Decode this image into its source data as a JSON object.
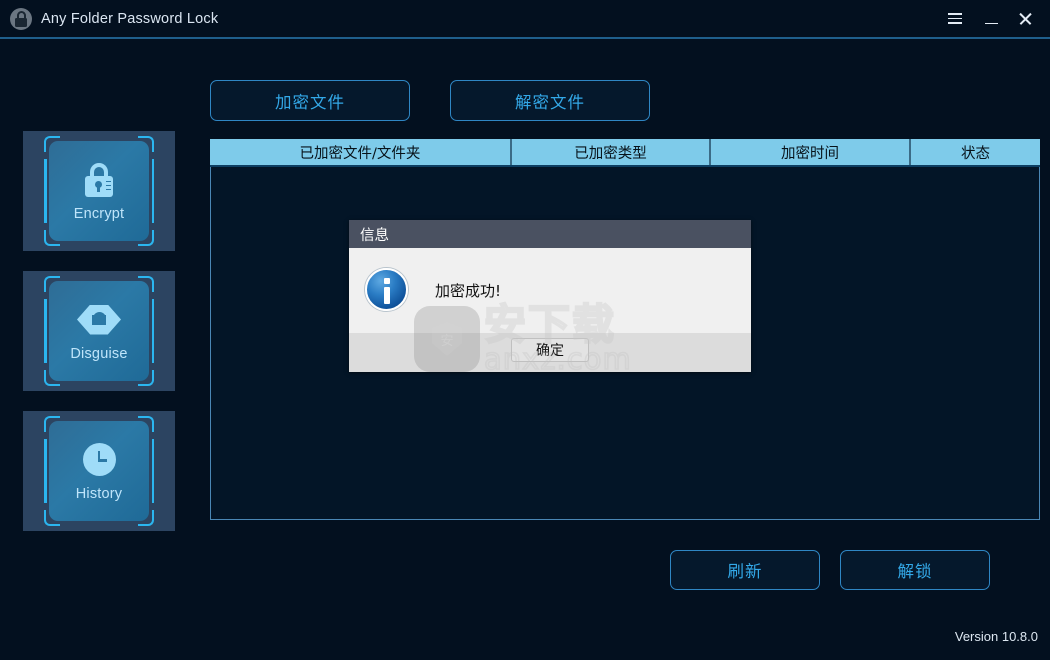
{
  "window": {
    "title": "Any Folder Password Lock",
    "logo_icon": "lock-logo-icon",
    "controls": {
      "menu_icon": "hamburger-menu-icon",
      "minimize_icon": "minimize-icon",
      "close_icon": "close-icon"
    }
  },
  "theme": {
    "background": "#03101f",
    "accent": "#33a8e8",
    "accent_border": "#2f86c4",
    "bracket": "#2bb6f0",
    "table_header_bg": "#7ecbea",
    "sidebar_card_bg": "#2c4461"
  },
  "sidebar": {
    "items": [
      {
        "label": "Encrypt",
        "icon": "lock-icon"
      },
      {
        "label": "Disguise",
        "icon": "disguise-mask-icon"
      },
      {
        "label": "History",
        "icon": "clock-icon"
      }
    ]
  },
  "tabs": [
    {
      "label": "加密文件",
      "active": true
    },
    {
      "label": "解密文件",
      "active": false
    }
  ],
  "table": {
    "columns": [
      "已加密文件/文件夹",
      "已加密类型",
      "加密时间",
      "状态"
    ],
    "rows": []
  },
  "footer": {
    "buttons": [
      {
        "label": "刷新"
      },
      {
        "label": "解锁"
      }
    ],
    "version": "Version 10.8.0"
  },
  "dialog": {
    "title": "信息",
    "icon": "info-icon",
    "message": "加密成功!",
    "ok_label": "确定"
  },
  "watermark": {
    "shield_glyph": "安",
    "cn_text": "安下载",
    "en_text": "anxz.com"
  }
}
